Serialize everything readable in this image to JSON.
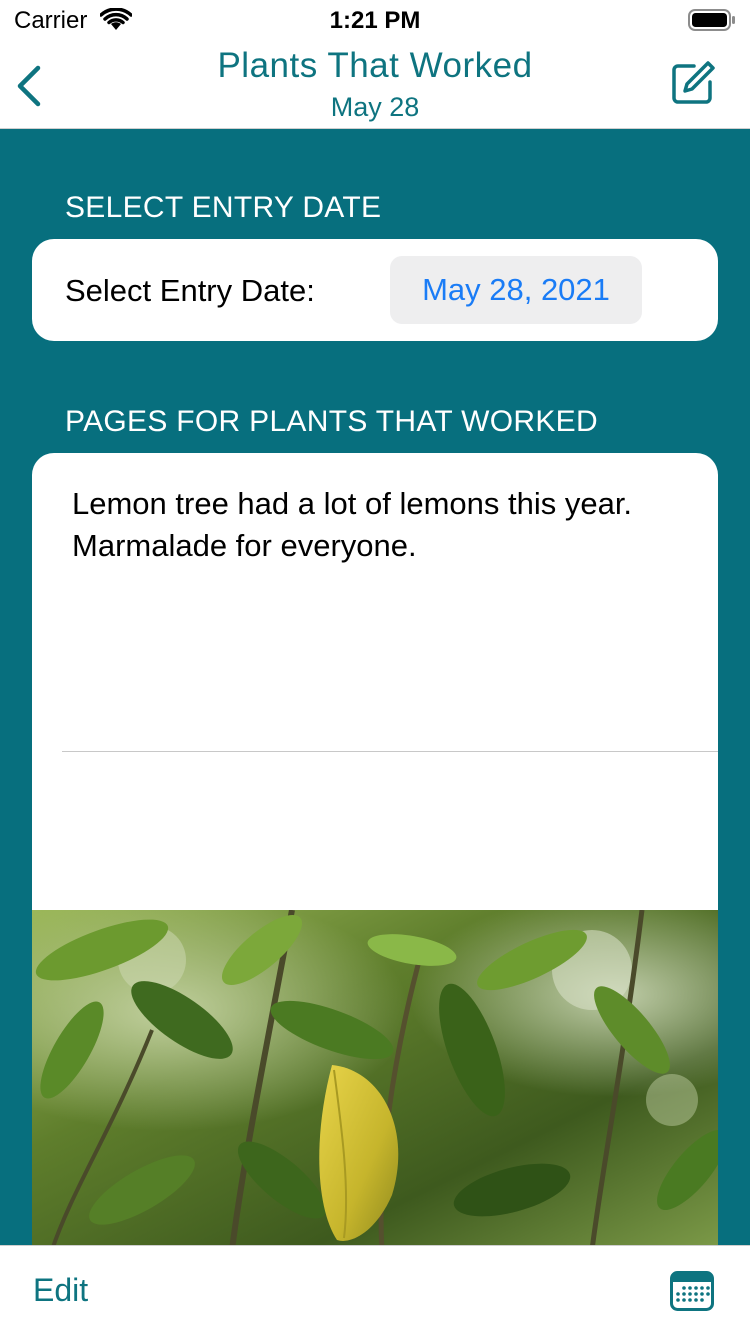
{
  "status_bar": {
    "carrier": "Carrier",
    "time": "1:21 PM"
  },
  "nav": {
    "title": "Plants That Worked",
    "subtitle": "May 28",
    "back_icon": "chevron-left-icon",
    "compose_icon": "compose-icon"
  },
  "date_section": {
    "header": "SELECT ENTRY DATE",
    "label": "Select Entry Date:",
    "value": "May 28, 2021"
  },
  "pages_section": {
    "header": "PAGES FOR PLANTS THAT WORKED",
    "note_text": "Lemon tree had a lot of lemons this year. Marmalade for everyone."
  },
  "toolbar": {
    "edit_label": "Edit",
    "calendar_icon": "calendar-icon"
  },
  "colors": {
    "brand_teal": "#076F7E",
    "nav_tint": "#0E7480",
    "date_link": "#1A7CF6"
  }
}
